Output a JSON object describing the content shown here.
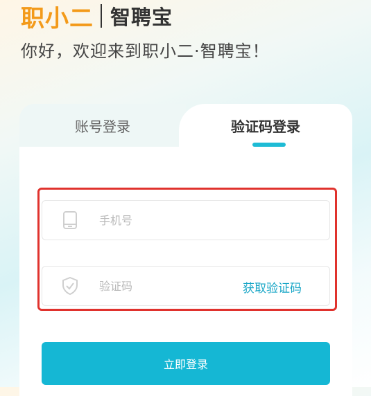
{
  "header": {
    "logo": "职小二",
    "product": "智聘宝",
    "greeting": "你好，欢迎来到职小二·智聘宝！"
  },
  "tabs": {
    "account": "账号登录",
    "sms": "验证码登录",
    "active": "sms"
  },
  "form": {
    "phone": {
      "value": "",
      "placeholder": "手机号",
      "icon": "tablet-icon"
    },
    "code": {
      "value": "",
      "placeholder": "验证码",
      "icon": "shield-check-icon",
      "action": "获取验证码"
    }
  },
  "login_button": "立即登录",
  "colors": {
    "brand_orange": "#f39a1a",
    "accent": "#15b7d4",
    "link": "#1ba7c7",
    "highlight": "#e0322d"
  }
}
